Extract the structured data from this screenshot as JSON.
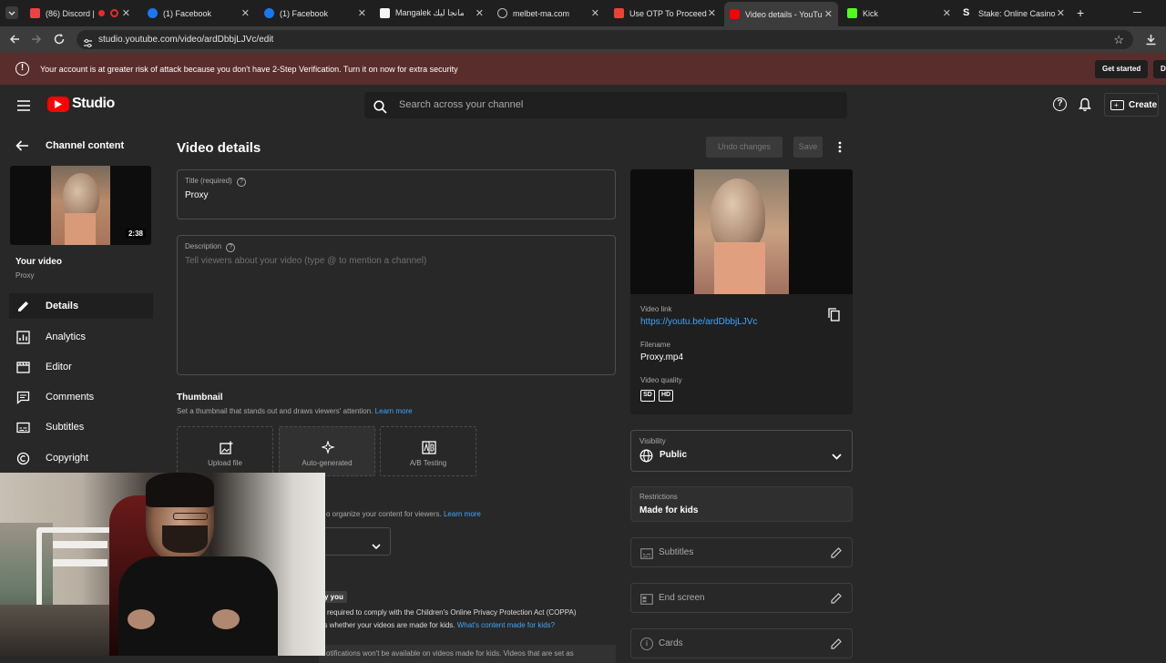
{
  "browser": {
    "tabs": [
      {
        "label": "(86) Discord |",
        "color": "#ed4245"
      },
      {
        "label": "(1) Facebook",
        "color": "#1877f2"
      },
      {
        "label": "(1) Facebook",
        "color": "#1877f2"
      },
      {
        "label": "Mangalek مانجا ليك",
        "color": "#f5f5f5"
      },
      {
        "label": "melbet-ma.com",
        "color": "#bdbdbd"
      },
      {
        "label": "Use OTP To Proceed",
        "color": "#ea4335"
      },
      {
        "label": "Video details - YouTu",
        "color": "#ff0000"
      },
      {
        "label": "Kick",
        "color": "#53fc18"
      },
      {
        "label": "Stake: Online Casino",
        "color": "#ffffff"
      }
    ],
    "url": "studio.youtube.com/video/ardDbbjLJVc/edit"
  },
  "banner": {
    "text": "Your account is at greater risk of attack because you don't have 2-Step Verification. Turn it on now for extra security",
    "button": "Get started",
    "button2": "D"
  },
  "header": {
    "logo": "Studio",
    "search_placeholder": "Search across your channel",
    "create": "Create"
  },
  "sidebar": {
    "back_label": "Channel content",
    "duration": "2:38",
    "your_video": "Your video",
    "video_name": "Proxy",
    "items": [
      {
        "label": "Details",
        "icon": "pencil-icon"
      },
      {
        "label": "Analytics",
        "icon": "analytics-icon"
      },
      {
        "label": "Editor",
        "icon": "editor-icon"
      },
      {
        "label": "Comments",
        "icon": "comments-icon"
      },
      {
        "label": "Subtitles",
        "icon": "subtitles-icon"
      },
      {
        "label": "Copyright",
        "icon": "copyright-icon"
      }
    ]
  },
  "main": {
    "page_title": "Video details",
    "undo": "Undo changes",
    "save": "Save",
    "title_label": "Title (required)",
    "title_value": "Proxy",
    "description_label": "Description",
    "description_placeholder": "Tell viewers about your video (type @ to mention a channel)",
    "thumbnail_heading": "Thumbnail",
    "thumbnail_desc": "Set a thumbnail that stands out and draws viewers' attention.",
    "learn_more": "Learn more",
    "thumb_upload": "Upload file",
    "thumb_auto": "Auto-generated",
    "thumb_ab": "A/B Testing",
    "playlist_desc": "o organize your content for viewers.",
    "playlist_learn": "Learn more",
    "audience_badge": "y you",
    "coppa_1": "required to comply with the Children's Online Privacy Protection Act (COPPA)",
    "coppa_2": "us whether your videos are made for kids.",
    "coppa_link": "What's content made for kids?",
    "coppa_3": "otifications won't be available on videos made for kids. Videos that are set as"
  },
  "panel": {
    "video_link_label": "Video link",
    "video_link": "https://youtu.be/ardDbbjLJVc",
    "filename_label": "Filename",
    "filename": "Proxy.mp4",
    "quality_label": "Video quality",
    "quality_sd": "SD",
    "quality_hd": "HD",
    "visibility_label": "Visibility",
    "visibility_value": "Public",
    "restrictions_label": "Restrictions",
    "restrictions_value": "Made for kids",
    "subtitles": "Subtitles",
    "end_screen": "End screen",
    "cards": "Cards"
  },
  "colors": {
    "link": "#3ea6ff",
    "banner_bg": "#5a2d2d",
    "brand_red": "#ff0000"
  }
}
